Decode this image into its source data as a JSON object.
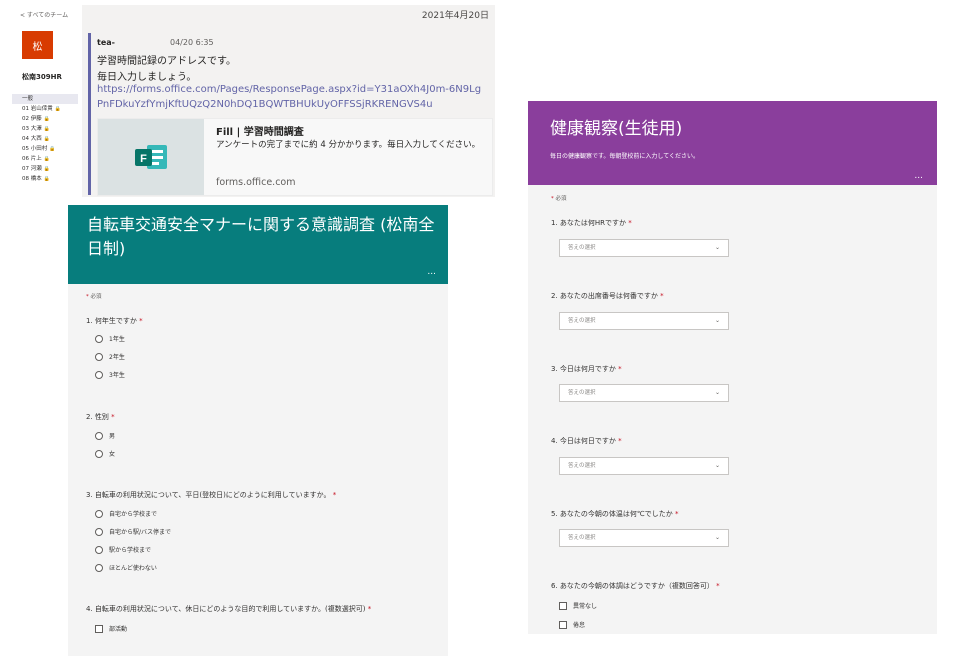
{
  "sidebar": {
    "back_label": "< すべてのチーム",
    "team_tile": "松",
    "team_name": "松南309HR",
    "channels": [
      {
        "label": "一般",
        "locked": false
      },
      {
        "label": "01 岩山倖貴",
        "locked": true
      },
      {
        "label": "02 伊藤",
        "locked": true
      },
      {
        "label": "03 大澤",
        "locked": true
      },
      {
        "label": "04 大西",
        "locked": true
      },
      {
        "label": "05 小田村",
        "locked": true
      },
      {
        "label": "06 片上",
        "locked": true
      },
      {
        "label": "07 河瀬",
        "locked": true
      },
      {
        "label": "08 橋本",
        "locked": true
      }
    ],
    "lock_glyph": "🔒"
  },
  "chat": {
    "date": "2021年4月20日",
    "author": "tea-",
    "time": "04/20 6:35",
    "line1": "学習時間記録のアドレスです。",
    "line2": "毎日入力しましょう。",
    "link1": "https://forms.office.com/Pages/ResponsePage.aspx?id=Y31aOXh4J0m-6N9Lg",
    "link2": "PnFDkuYzfYmjKftUQzQ2N0hDQ1BQWTBHUkUyOFFSSjRKRENGVS4u",
    "card": {
      "title": "Fill | 学習時間調査",
      "description": "アンケートの完了までに約 4 分かかります。毎日入力してください。",
      "domain": "forms.office.com",
      "icon": "forms-app-icon"
    }
  },
  "form_left": {
    "title": "自転車交通安全マナーに関する意識調査 (松南全日制)",
    "dots": "...",
    "required_note": "必須",
    "questions": [
      {
        "label": "1. 何年生ですか",
        "options": [
          "1年生",
          "2年生",
          "3年生"
        ],
        "kind": "radio"
      },
      {
        "label": "2. 性別",
        "options": [
          "男",
          "女"
        ],
        "kind": "radio"
      },
      {
        "label": "3. 自転車の利用状況について、平日(登校日)にどのように利用していますか。",
        "options": [
          "自宅から学校まで",
          "自宅から駅/バス停まで",
          "駅から学校まで",
          "ほとんど使わない"
        ],
        "kind": "radio"
      },
      {
        "label": "4. 自転車の利用状況について、休日にどのような目的で利用していますか。(複数選択可)",
        "options": [
          "部活動"
        ],
        "kind": "checkbox"
      }
    ]
  },
  "form_right": {
    "title": "健康観察(生徒用)",
    "subtitle": "毎日の健康観察です。毎朝登校前に入力してください。",
    "dots": "...",
    "required_note": "必須",
    "questions": [
      {
        "label": "1. あなたは何HRですか",
        "placeholder": "答えの選択",
        "kind": "dropdown"
      },
      {
        "label": "2. あなたの出席番号は何番ですか",
        "placeholder": "答えの選択",
        "kind": "dropdown"
      },
      {
        "label": "3. 今日は何月ですか",
        "placeholder": "答えの選択",
        "kind": "dropdown"
      },
      {
        "label": "4. 今日は何日ですか",
        "placeholder": "答えの選択",
        "kind": "dropdown"
      },
      {
        "label": "5. あなたの今朝の体温は何℃でしたか",
        "placeholder": "答えの選択",
        "kind": "dropdown"
      },
      {
        "label": "6. あなたの今朝の体調はどうですか（複数回答可）",
        "options": [
          "異常なし",
          "倦怠"
        ],
        "kind": "checkbox"
      }
    ],
    "chevron": "⌄"
  },
  "colors": {
    "teams_purple": "#6264a7",
    "team_tile": "#d83b01",
    "form_left_header": "#077d7d",
    "form_right_header": "#8a3e9c",
    "required_star": "#c50f1f"
  }
}
